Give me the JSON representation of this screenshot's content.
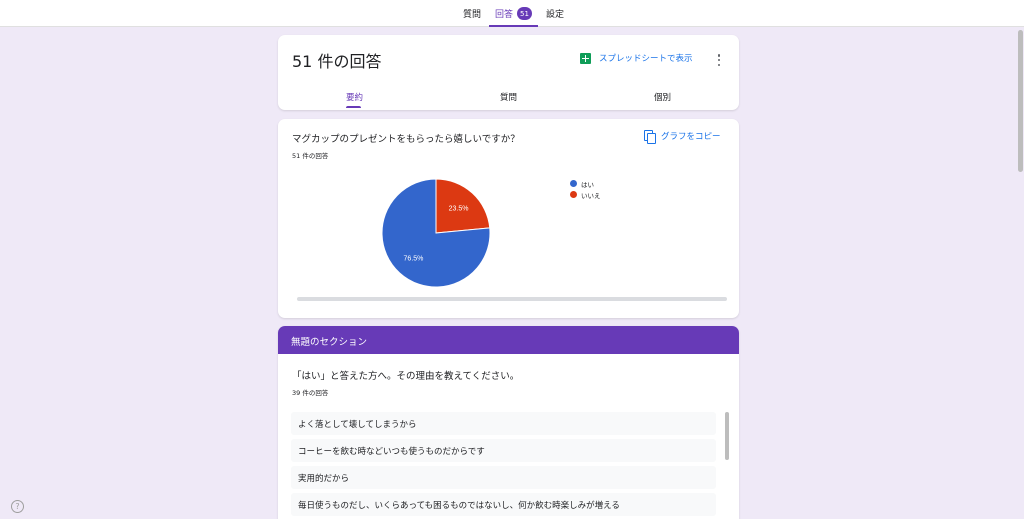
{
  "top_tabs": {
    "questions": "質問",
    "responses": "回答",
    "response_count": "51",
    "settings": "設定"
  },
  "header": {
    "title": "51 件の回答",
    "sheet_button": "スプレッドシートで表示",
    "tabs": [
      "要約",
      "質問",
      "個別"
    ]
  },
  "chart_card": {
    "question": "マグカップのプレゼントをもらったら嬉しいですか？",
    "response_count": "51 件の回答",
    "copy_button": "グラフをコピー"
  },
  "chart_data": {
    "type": "pie",
    "categories": [
      "はい",
      "いいえ"
    ],
    "values": [
      76.5,
      23.5
    ],
    "labels": [
      "76.5%",
      "23.5%"
    ],
    "colors": [
      "#3366cc",
      "#dc3912"
    ],
    "legend_position": "right"
  },
  "section": {
    "title": "無題のセクション",
    "question": "「はい」と答えた方へ。その理由を教えてください。",
    "response_count": "39 件の回答",
    "answers": [
      "よく落として壊してしまうから",
      "コーヒーを飲む時などいつも使うものだからです",
      "実用的だから",
      "毎日使うものだし、いくらあっても困るものではないし、何か飲む時楽しみが増える"
    ]
  },
  "help": {
    "icon": "?"
  }
}
